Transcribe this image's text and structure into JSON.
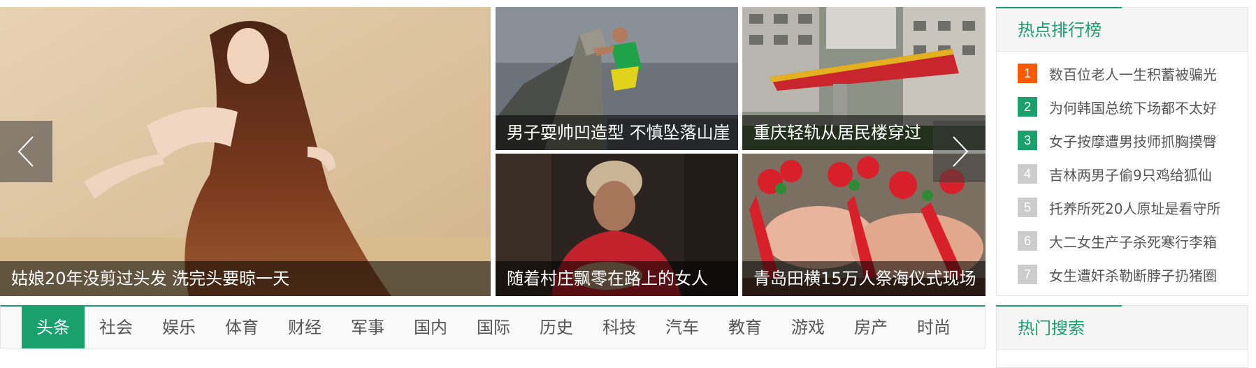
{
  "slider": {
    "main": {
      "caption": "姑娘20年没剪过头发 洗完头要晾一天"
    },
    "tiles": [
      {
        "caption": "男子耍帅凹造型 不慎坠落山崖"
      },
      {
        "caption": "重庆轻轨从居民楼穿过"
      },
      {
        "caption": "随着村庄飘零在路上的女人"
      },
      {
        "caption": "青岛田横15万人祭海仪式现场"
      }
    ]
  },
  "hot_rank": {
    "title": "热点排行榜",
    "items": [
      {
        "num": "1",
        "text": "数百位老人一生积蓄被骗光",
        "color": "#ff5a00"
      },
      {
        "num": "2",
        "text": "为何韩国总统下场都不太好",
        "color": "#1aa06d"
      },
      {
        "num": "3",
        "text": "女子按摩遭男技师抓胸摸臀",
        "color": "#1aa06d"
      },
      {
        "num": "4",
        "text": "吉林两男子偷9只鸡给狐仙",
        "color": "#cccccc"
      },
      {
        "num": "5",
        "text": "托养所死20人原址是看守所",
        "color": "#cccccc"
      },
      {
        "num": "6",
        "text": "大二女生产子杀死寒行李箱",
        "color": "#cccccc"
      },
      {
        "num": "7",
        "text": "女生遭奸杀勒断脖子扔猪圈",
        "color": "#cccccc"
      }
    ]
  },
  "hot_search": {
    "title": "热门搜索"
  },
  "nav": {
    "tabs": [
      "头条",
      "社会",
      "娱乐",
      "体育",
      "财经",
      "军事",
      "国内",
      "国际",
      "历史",
      "科技",
      "汽车",
      "教育",
      "游戏",
      "房产",
      "时尚"
    ],
    "active_index": 0
  },
  "colors": {
    "accent": "#1aa06d",
    "rank_top": "#ff5a00",
    "rank_muted": "#cccccc"
  },
  "icons": {
    "prev": "chevron-left-icon",
    "next": "chevron-right-icon"
  }
}
